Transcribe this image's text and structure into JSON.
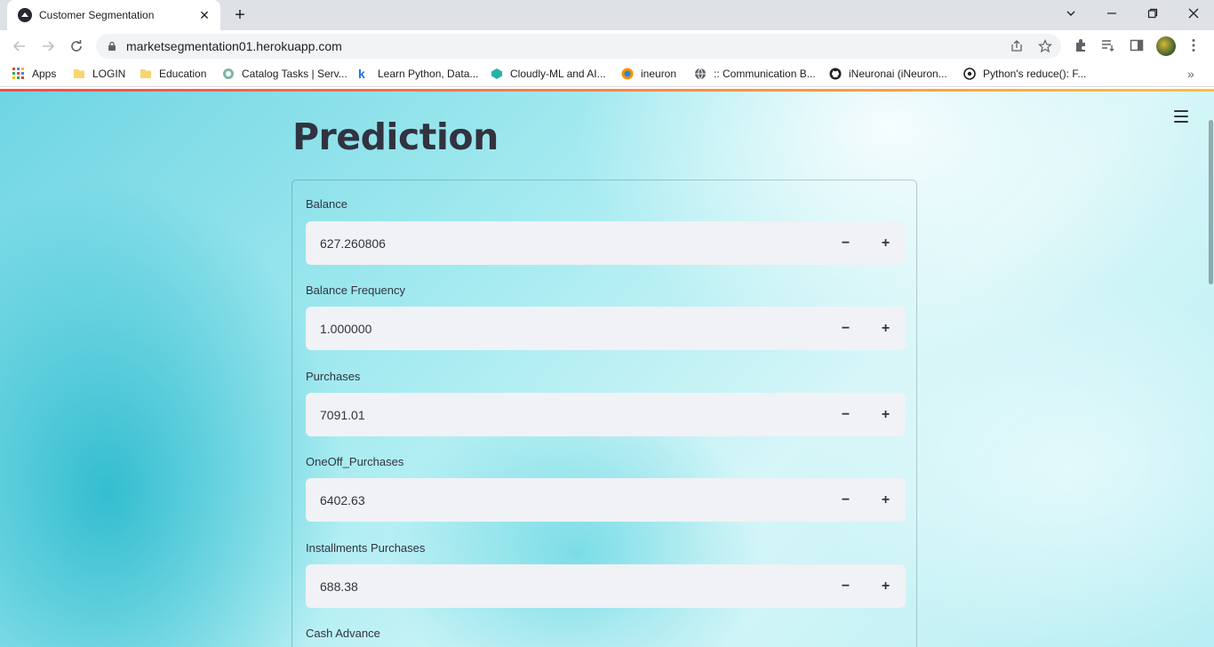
{
  "browser": {
    "tab_title": "Customer Segmentation",
    "url": "marketsegmentation01.herokuapp.com"
  },
  "bookmarks": [
    {
      "label": "Apps",
      "icon": "apps-grid-icon"
    },
    {
      "label": "LOGIN",
      "icon": "folder-icon"
    },
    {
      "label": "Education",
      "icon": "folder-icon"
    },
    {
      "label": "Catalog Tasks | Serv...",
      "icon": "servicenow-icon"
    },
    {
      "label": "Learn Python, Data...",
      "icon": "k-icon"
    },
    {
      "label": "Cloudly-ML and AI...",
      "icon": "cloudly-icon"
    },
    {
      "label": "ineuron",
      "icon": "ineuron-icon"
    },
    {
      "label": ":: Communication B...",
      "icon": "globe-icon"
    },
    {
      "label": "iNeuronai (iNeuron...",
      "icon": "github-icon"
    },
    {
      "label": "Python's reduce(): F...",
      "icon": "python-icon"
    }
  ],
  "page": {
    "title": "Prediction",
    "fields": [
      {
        "label": "Balance",
        "value": "627.260806"
      },
      {
        "label": "Balance Frequency",
        "value": "1.000000"
      },
      {
        "label": "Purchases",
        "value": "7091.01"
      },
      {
        "label": "OneOff_Purchases",
        "value": "6402.63"
      },
      {
        "label": "Installments Purchases",
        "value": "688.38"
      },
      {
        "label": "Cash Advance",
        "value": ""
      }
    ],
    "minus_label": "−",
    "plus_label": "+"
  },
  "colors": {
    "accent": "#ff4b4b",
    "text": "#31333f",
    "input_bg": "#f0f2f6"
  }
}
